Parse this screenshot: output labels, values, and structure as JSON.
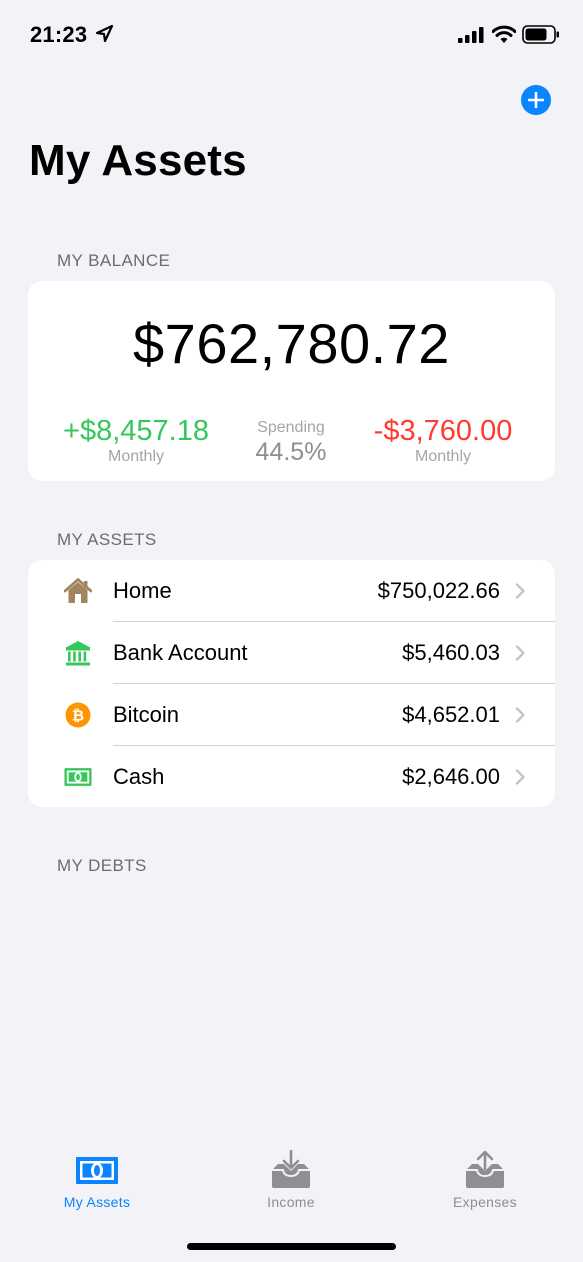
{
  "status_bar": {
    "time": "21:23"
  },
  "header": {
    "title": "My Assets"
  },
  "balance": {
    "section_label": "MY BALANCE",
    "total": "$762,780.72",
    "income": {
      "value": "+$8,457.18",
      "caption": "Monthly"
    },
    "spending": {
      "label": "Spending",
      "value": "44.5%"
    },
    "expenses": {
      "value": "-$3,760.00",
      "caption": "Monthly"
    }
  },
  "assets": {
    "section_label": "MY ASSETS",
    "items": [
      {
        "label": "Home",
        "value": "$750,022.66",
        "icon": "house-icon"
      },
      {
        "label": "Bank Account",
        "value": "$5,460.03",
        "icon": "bank-icon"
      },
      {
        "label": "Bitcoin",
        "value": "$4,652.01",
        "icon": "bitcoin-icon"
      },
      {
        "label": "Cash",
        "value": "$2,646.00",
        "icon": "cash-icon"
      }
    ]
  },
  "debts": {
    "section_label": "MY DEBTS"
  },
  "tabs": [
    {
      "label": "My Assets",
      "icon": "banknote-icon",
      "active": true
    },
    {
      "label": "Income",
      "icon": "tray-download-icon",
      "active": false
    },
    {
      "label": "Expenses",
      "icon": "tray-upload-icon",
      "active": false
    }
  ],
  "colors": {
    "accent": "#0a84ff",
    "positive": "#34c759",
    "negative": "#ff3b30",
    "inactive_tab": "#8e8e93"
  }
}
